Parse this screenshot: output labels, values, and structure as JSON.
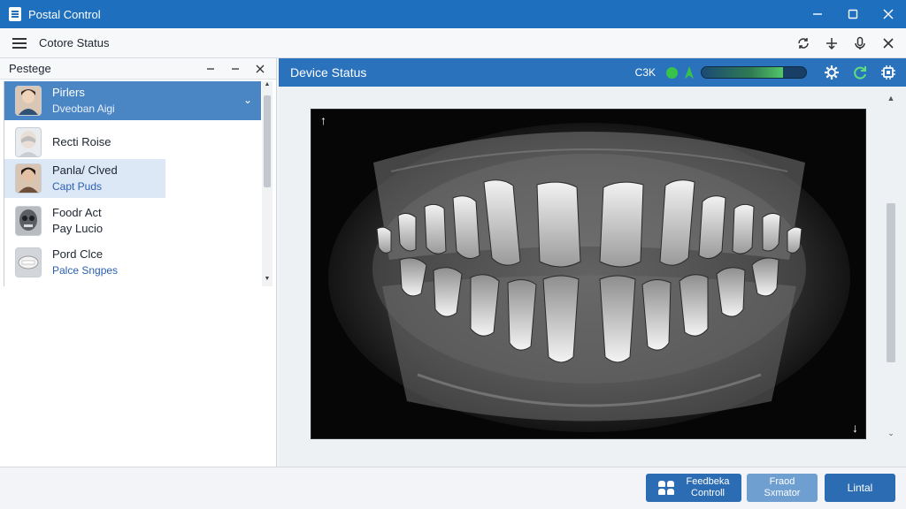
{
  "window": {
    "title": "Postal Control"
  },
  "toolbar": {
    "page_title": "Cotore Status"
  },
  "left_panel": {
    "title": "Pestege",
    "patients": [
      {
        "name": "Pirlers",
        "sub": "Dveoban Aigi",
        "selected": true
      },
      {
        "name": "Recti Roise",
        "sub": ""
      },
      {
        "name": "Panla/ Clved",
        "sub": "Capt Puds",
        "highlighted": true
      },
      {
        "name": "Foodr Act",
        "sub": "Pay Lucio"
      },
      {
        "name": "Pord Clce",
        "sub": "Palce Sngpes"
      }
    ]
  },
  "right_panel": {
    "title": "Device Status",
    "status_code": "C3K",
    "signal_level": 0.78,
    "colors": {
      "ok": "#37c24a",
      "header": "#2b72bd"
    }
  },
  "footer": {
    "buttons": [
      {
        "label_line1": "Feedbeka",
        "label_line2": "Controll"
      },
      {
        "label_line1": "Fraod",
        "label_line2": "Sxmator"
      },
      {
        "label_line1": "Lintal",
        "label_line2": ""
      }
    ]
  }
}
